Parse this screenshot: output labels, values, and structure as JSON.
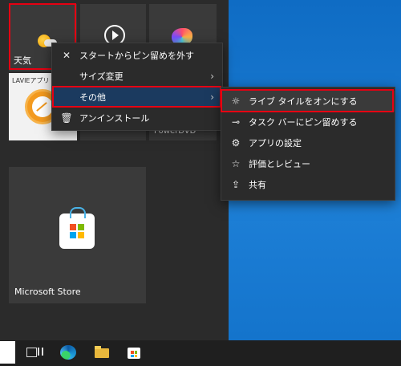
{
  "tiles": {
    "weather_label": "天気",
    "lavie_label": "LAVIEアプリ",
    "power_label": "PowerDVD",
    "store_label": "Microsoft Store"
  },
  "context_menu": {
    "items": [
      {
        "label": "スタートからピン留めを外す",
        "icon": "unpin-icon"
      },
      {
        "label": "サイズ変更",
        "icon": "none"
      },
      {
        "label": "その他",
        "icon": "none"
      },
      {
        "label": "アンインストール",
        "icon": "trash-icon"
      }
    ]
  },
  "submenu": {
    "items": [
      {
        "label": "ライブ タイルをオンにする",
        "icon": "live-tile-icon"
      },
      {
        "label": "タスク バーにピン留めする",
        "icon": "pin-icon"
      },
      {
        "label": "アプリの設定",
        "icon": "gear-icon"
      },
      {
        "label": "評価とレビュー",
        "icon": "star-icon"
      },
      {
        "label": "共有",
        "icon": "share-icon"
      }
    ]
  },
  "colors": {
    "highlight": "#e60012",
    "desktop": "#1a7bd2",
    "menu_bg": "#2b2b2b",
    "selected_bg": "#1b3a5f"
  }
}
